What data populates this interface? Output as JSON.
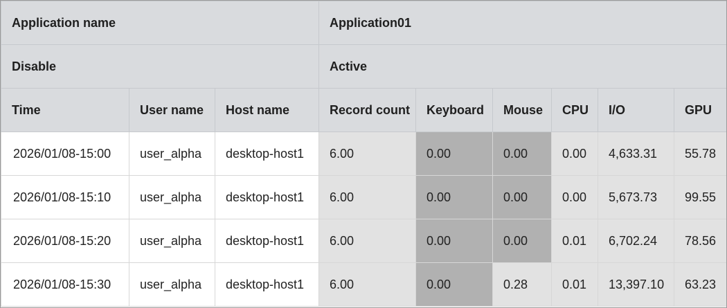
{
  "summary": {
    "app_name_label": "Application name",
    "app_name_value": "Application01",
    "disable_label": "Disable",
    "disable_value": "Active"
  },
  "columns": [
    "Time",
    "User name",
    "Host name",
    "Record count",
    "Keyboard",
    "Mouse",
    "CPU",
    "I/O",
    "GPU"
  ],
  "rows": [
    {
      "time": "2026/01/08-15:00",
      "user": "user_alpha",
      "host": "desktop-host1",
      "record_count": "6.00",
      "keyboard": "0.00",
      "mouse": "0.00",
      "cpu": "0.00",
      "io": "4,633.31",
      "gpu": "55.78"
    },
    {
      "time": "2026/01/08-15:10",
      "user": "user_alpha",
      "host": "desktop-host1",
      "record_count": "6.00",
      "keyboard": "0.00",
      "mouse": "0.00",
      "cpu": "0.00",
      "io": "5,673.73",
      "gpu": "99.55"
    },
    {
      "time": "2026/01/08-15:20",
      "user": "user_alpha",
      "host": "desktop-host1",
      "record_count": "6.00",
      "keyboard": "0.00",
      "mouse": "0.00",
      "cpu": "0.01",
      "io": "6,702.24",
      "gpu": "78.56"
    },
    {
      "time": "2026/01/08-15:30",
      "user": "user_alpha",
      "host": "desktop-host1",
      "record_count": "6.00",
      "keyboard": "0.00",
      "mouse": "0.28",
      "cpu": "0.01",
      "io": "13,397.10",
      "gpu": "63.23"
    }
  ],
  "colors": {
    "header_bg": "#d9dbde",
    "cell_light": "#e2e2e2",
    "cell_dark": "#b1b1b1",
    "cell_white": "#ffffff"
  }
}
